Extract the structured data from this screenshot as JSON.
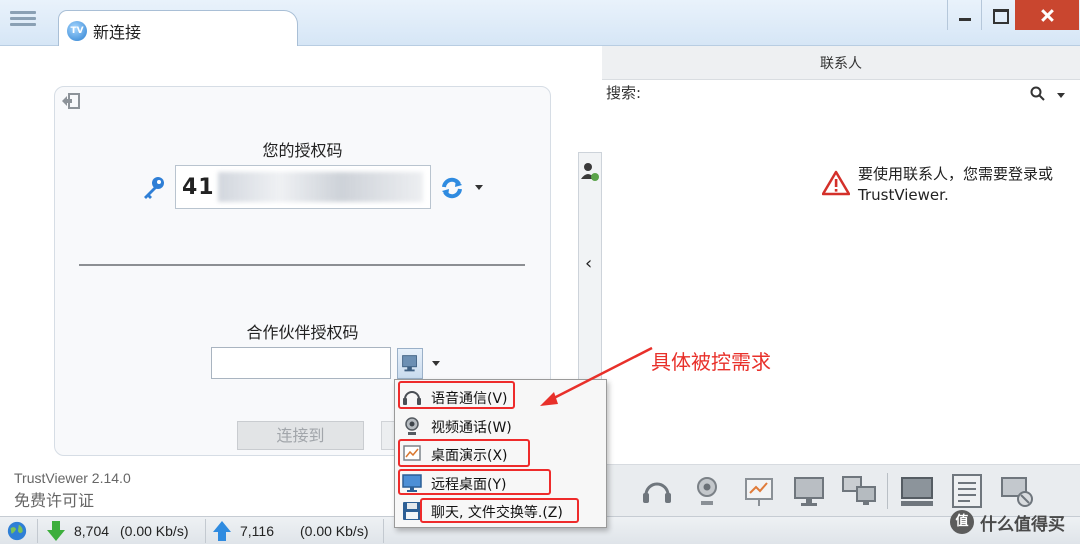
{
  "window": {
    "tab_title": "新连接",
    "tab_icon": "teamviewer-logo-icon",
    "close_color": "#c9462f"
  },
  "connect_panel": {
    "my_code_label": "您的授权码",
    "my_code_visible": "41",
    "partner_label": "合作伙伴授权码",
    "partner_input_value": "",
    "connect_button": "连接到",
    "version": "TrustViewer 2.14.0",
    "license": "免费许可证"
  },
  "contacts_panel": {
    "header": "联系人",
    "search_label": "搜索:",
    "warning_line1": "要使用联系人，您需要登录或",
    "warning_line2": "TrustViewer."
  },
  "mode_menu": {
    "items": [
      {
        "label": "语音通信(V)",
        "icon": "headset-icon",
        "highlighted": true
      },
      {
        "label": "视频通话(W)",
        "icon": "webcam-icon",
        "highlighted": false
      },
      {
        "label": "桌面演示(X)",
        "icon": "presentation-icon",
        "highlighted": true
      },
      {
        "label": "远程桌面(Y)",
        "icon": "monitor-icon",
        "highlighted": true
      },
      {
        "label": "聊天, 文件交换等.(Z)",
        "icon": "floppy-disk-icon",
        "highlighted": true
      }
    ]
  },
  "annotation": {
    "text": "具体被控需求",
    "color": "#e8302a"
  },
  "status_bar": {
    "download_value": "8,704",
    "download_rate": "(0.00 Kb/s)",
    "upload_value": "7,116",
    "upload_rate": "(0.00 Kb/s)"
  },
  "watermark": {
    "logo_text": "值",
    "text": "什么值得买"
  }
}
